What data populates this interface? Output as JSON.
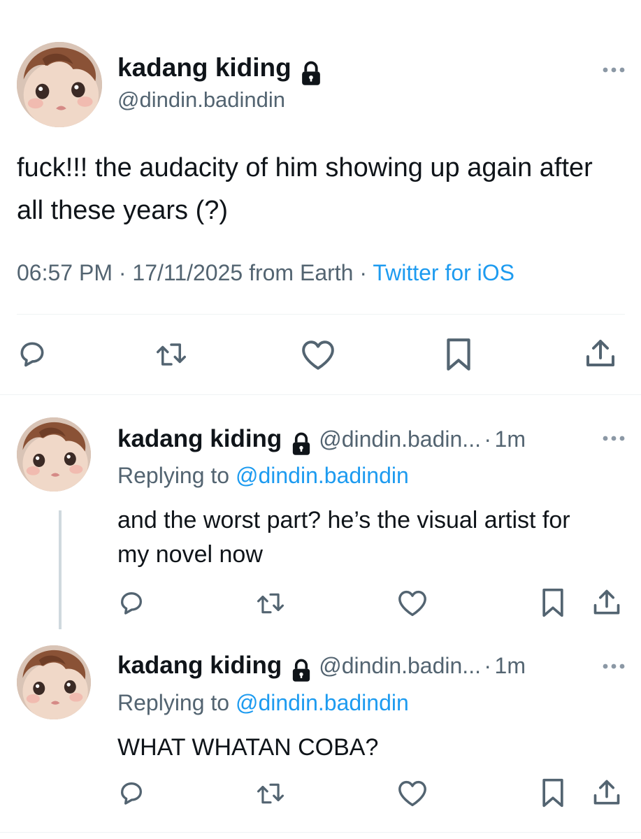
{
  "main_tweet": {
    "display_name": "kadang kiding",
    "handle": "@dindin.badindin",
    "text": "fuck!!! the audacity of him showing up again after all these years (?)",
    "time": "06:57 PM",
    "date": "17/11/2025",
    "location": "from Earth",
    "source": "Twitter for iOS",
    "separator": "·"
  },
  "replies": [
    {
      "display_name": "kadang kiding",
      "handle": "@dindin.badin...",
      "age": "1m",
      "replying_label": "Replying to",
      "replying_handle": "@dindin.badindin",
      "text": "and the worst part? he’s the visual artist for my novel now"
    },
    {
      "display_name": "kadang kiding",
      "handle": "@dindin.badin...",
      "age": "1m",
      "replying_label": "Replying to",
      "replying_handle": "@dindin.badindin",
      "text": "WHAT WHATAN COBA?"
    }
  ],
  "icons": {
    "lock": "lock-icon",
    "more": "more-horizontal-icon",
    "reply": "reply-bubble-icon",
    "retweet": "retweet-icon",
    "like": "heart-icon",
    "bookmark": "bookmark-icon",
    "share": "share-icon"
  },
  "colors": {
    "text": "#0f1419",
    "muted": "#536471",
    "link": "#1d9bf0",
    "divider": "#eff3f4"
  }
}
